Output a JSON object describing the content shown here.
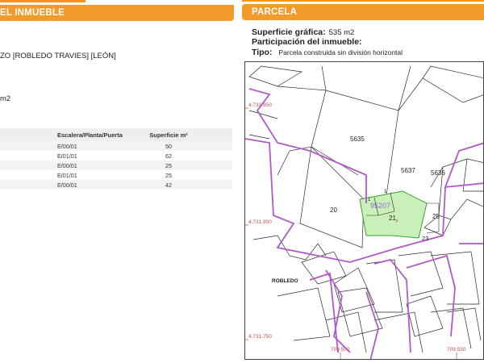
{
  "left_panel": {
    "header": "EL INMUEBLE",
    "location_fragment": "ZO [ROBLEDO TRAVIES] [LEÓN]",
    "surface_fragment": "m2",
    "table": {
      "headers": [
        "Escalera/Planta/Puerta",
        "Superficie m²"
      ],
      "rows": [
        {
          "location": "E/00/01",
          "surface": "50"
        },
        {
          "location": "E/01/01",
          "surface": "62"
        },
        {
          "location": "E/00/01",
          "surface": "25"
        },
        {
          "location": "E/01/01",
          "surface": "25"
        },
        {
          "location": "E/00/01",
          "surface": "42"
        }
      ]
    }
  },
  "right_panel": {
    "header": "PARCELA",
    "graphic_surface_label": "Superficie gráfica:",
    "graphic_surface_value": "535 m2",
    "participation_label": "Participación del inmueble:",
    "type_label": "Tipo:",
    "type_value": "Parcela construida sin división horizontal"
  },
  "map": {
    "parcel_labels": [
      "5635",
      "5637",
      "5636",
      "20",
      "25",
      "23"
    ],
    "highlight_label": "21",
    "highlight_suffix": "p",
    "ref_label": "95207",
    "sub_labels": [
      "1",
      "1"
    ],
    "street_label": "ROBLEDO",
    "coord_labels": [
      "4.731.850",
      "4.731.800",
      "4.731.750",
      "709.500",
      "709.550"
    ],
    "colors": {
      "boundary": "#b05ac8",
      "highlight_fill": "#c8f0b8",
      "highlight_stroke": "#3aa030",
      "ref_text": "#8a6ad0",
      "coord_text": "#c05050"
    }
  }
}
